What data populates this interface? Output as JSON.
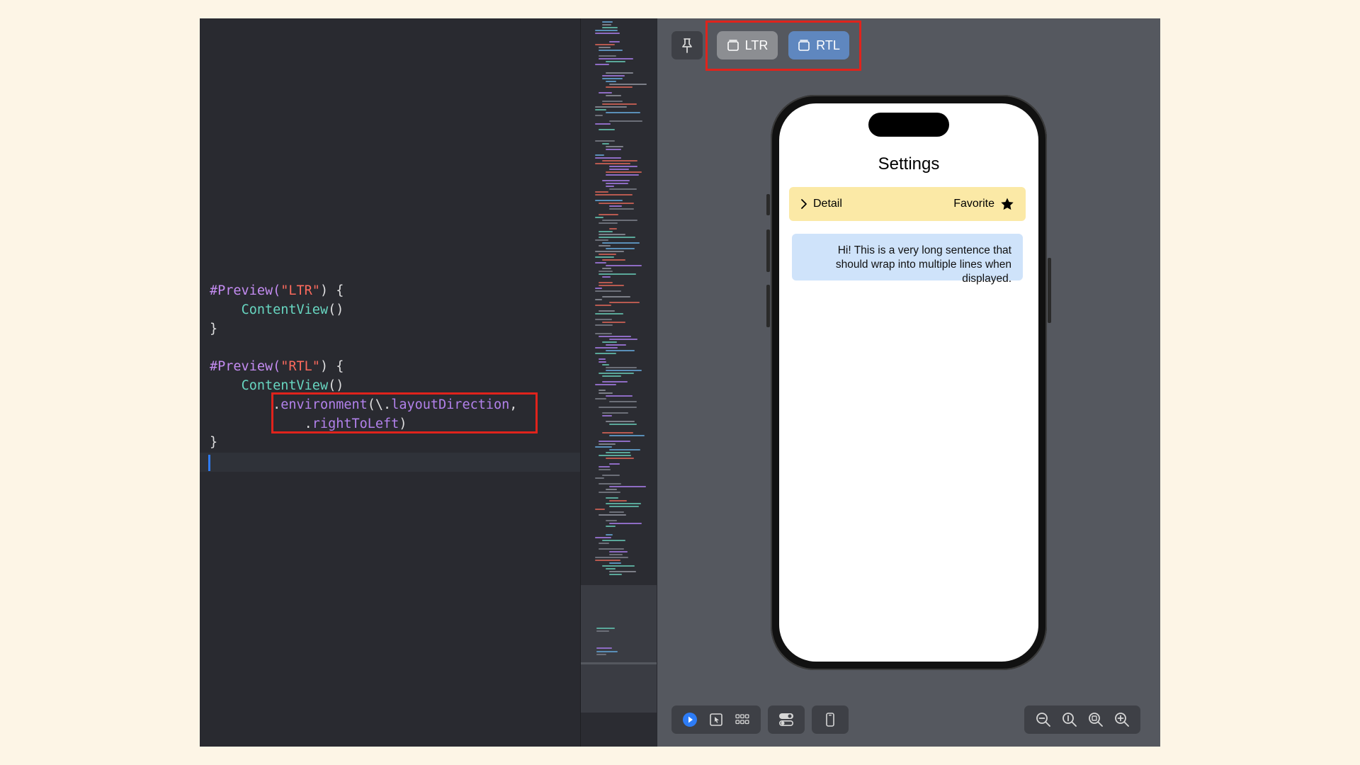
{
  "editor": {
    "lines": [
      [
        {
          "t": "#Preview(",
          "c": "kw-macro"
        },
        {
          "t": "\"LTR\"",
          "c": "str"
        },
        {
          "t": ") {",
          "c": ""
        }
      ],
      [
        {
          "t": "    ",
          "c": ""
        },
        {
          "t": "ContentView",
          "c": "type"
        },
        {
          "t": "()",
          "c": ""
        }
      ],
      [
        {
          "t": "}",
          "c": ""
        }
      ],
      [],
      [
        {
          "t": "#Preview(",
          "c": "kw-macro"
        },
        {
          "t": "\"RTL\"",
          "c": "str"
        },
        {
          "t": ") {",
          "c": ""
        }
      ],
      [
        {
          "t": "    ",
          "c": ""
        },
        {
          "t": "ContentView",
          "c": "type"
        },
        {
          "t": "()",
          "c": ""
        }
      ],
      [
        {
          "t": "        .",
          "c": ""
        },
        {
          "t": "environment",
          "c": "member"
        },
        {
          "t": "(\\.",
          "c": ""
        },
        {
          "t": "layoutDirection",
          "c": "member"
        },
        {
          "t": ",",
          "c": ""
        }
      ],
      [
        {
          "t": "            .",
          "c": ""
        },
        {
          "t": "rightToLeft",
          "c": "member"
        },
        {
          "t": ")",
          "c": ""
        }
      ],
      [
        {
          "t": "}",
          "c": ""
        }
      ]
    ]
  },
  "preview": {
    "variants": {
      "ltr_label": "LTR",
      "rtl_label": "RTL"
    },
    "app": {
      "title": "Settings",
      "detail_label": "Detail",
      "favorite_label": "Favorite",
      "message": "Hi! This is a very long sentence that should wrap into multiple lines when displayed."
    }
  },
  "colors": {
    "highlight": "#e0231c",
    "detail_bg": "#fbe9a6",
    "message_bg": "#cfe3fa",
    "rtl_button": "#5f87bf"
  }
}
